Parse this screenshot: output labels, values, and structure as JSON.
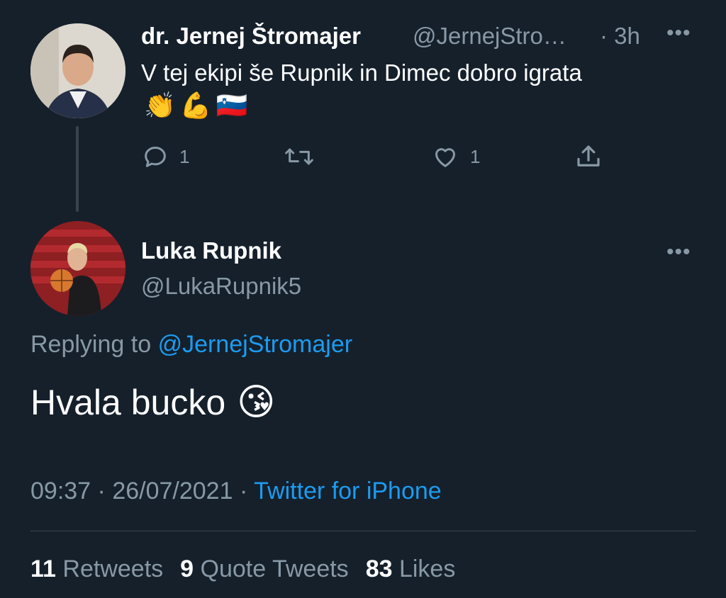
{
  "parent_tweet": {
    "author_name": "dr. Jernej Štromajer",
    "author_handle": "@JernejStro…",
    "age": "· 3h",
    "text": "V tej ekipi še Rupnik in Dimec dobro igrata",
    "emojis": [
      "👏",
      "💪",
      "🇸🇮"
    ],
    "reply_count": "1",
    "like_count": "1"
  },
  "reply_tweet": {
    "author_name": "Luka Rupnik",
    "author_handle": "@LukaRupnik5",
    "replying_to_prefix": "Replying to",
    "replying_to_handle": "@JernejStromajer",
    "text": "Hvala bucko",
    "emoji": "😘",
    "time": "09:37",
    "date": "26/07/2021",
    "separator": "·",
    "client": "Twitter for iPhone"
  },
  "stats": {
    "retweets_count": "11",
    "retweets_label": "Retweets",
    "quotes_count": "9",
    "quotes_label": "Quote Tweets",
    "likes_count": "83",
    "likes_label": "Likes"
  },
  "colors": {
    "background": "#15202b",
    "text": "#ffffff",
    "muted": "#8899a6",
    "link": "#1d9bf0",
    "divider": "#38444d"
  },
  "icons": [
    "reply-icon",
    "retweet-icon",
    "like-icon",
    "share-icon",
    "more-icon"
  ]
}
